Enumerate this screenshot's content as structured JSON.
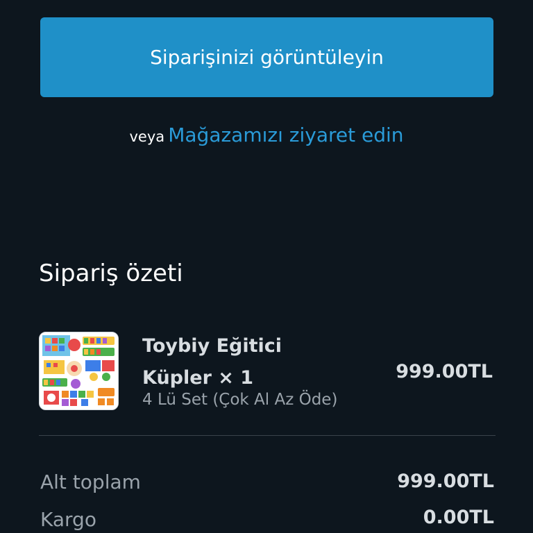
{
  "actions": {
    "view_order_label": "Siparişinizi görüntüleyin",
    "or_word": "veya",
    "visit_store_label": "Mağazamızı ziyaret edin"
  },
  "summary": {
    "title": "Sipariş özeti",
    "item": {
      "name_line1": "Toybiy Eğitici",
      "name_line2": "Küpler × 1",
      "variant": "4 Lü Set (Çok Al Az Öde)",
      "price": "999.00TL"
    },
    "subtotal": {
      "label": "Alt toplam",
      "value": "999.00TL"
    },
    "shipping": {
      "label": "Kargo",
      "value": "0.00TL"
    }
  },
  "colors": {
    "background": "#0d161e",
    "primary_button": "#1f90c8",
    "link": "#2a9bd8",
    "thumbnail_icon": "educational-cubes-product-image"
  }
}
